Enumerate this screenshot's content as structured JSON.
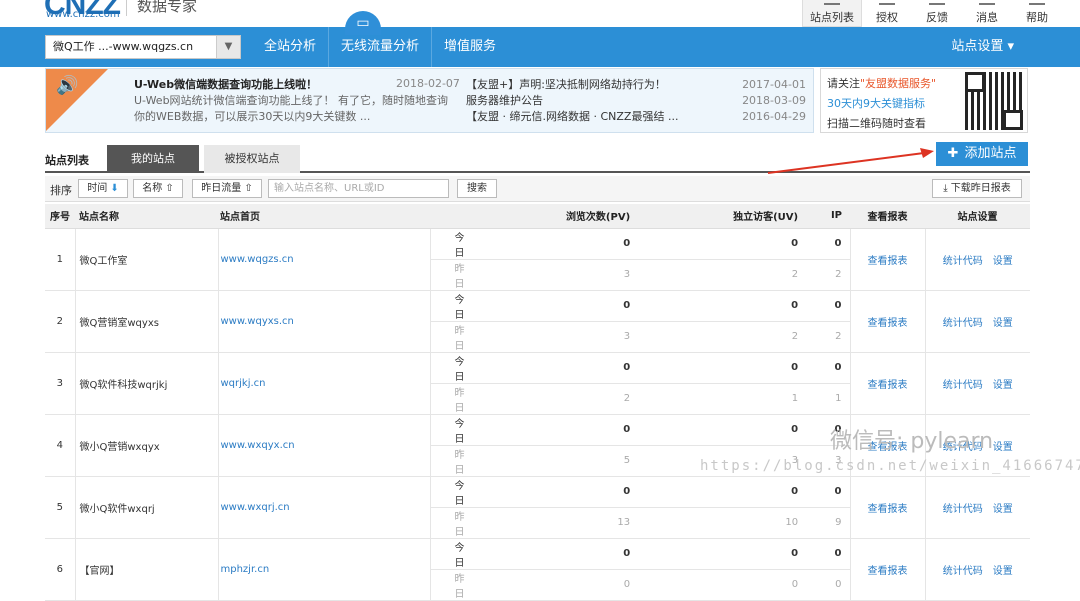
{
  "brand": {
    "logo": "CNZZ",
    "url": "www.cnzz.com",
    "product": "数据专家"
  },
  "top_nav": [
    {
      "label": "站点列表",
      "active": true
    },
    {
      "label": "授权"
    },
    {
      "label": "反馈"
    },
    {
      "label": "消息"
    },
    {
      "label": "帮助"
    }
  ],
  "site_select": "微Q工作 ...-www.wqgzs.cn",
  "menu": [
    "全站分析",
    "无线流量分析",
    "增值服务"
  ],
  "settings": "站点设置",
  "notice": {
    "headline": "U-Web微信端数据查询功能上线啦！",
    "headline_date": "2018-02-07",
    "body": "U-Web网站统计微信端查询功能上线了！ 有了它，随时随地查询你的WEB数据，可以展示30天以内9大关键数 ...",
    "items": [
      {
        "text": "【友盟+】声明:坚决抵制网络劫持行为！",
        "date": "2017-04-01"
      },
      {
        "text": "服务器维护公告",
        "date": "2018-03-09"
      },
      {
        "text": "【友盟 · 缔元信.网络数据 · CNZZ最强结 ...",
        "date": "2016-04-29"
      }
    ]
  },
  "qr": {
    "line1_pre": "请关注",
    "line1_hl": "\"友盟数据服务\"",
    "line2": "30天内9大关键指标",
    "line3": "扫描二维码随时查看"
  },
  "tabs": {
    "label": "站点列表",
    "mine": "我的站点",
    "authorized": "被授权站点"
  },
  "add_button": "添加站点",
  "toolbar": {
    "sort_label": "排序",
    "time": "时间",
    "name": "名称",
    "yesterday": "昨日流量",
    "search_placeholder": "输入站点名称、URL或ID",
    "search": "搜索",
    "download": "下载昨日报表"
  },
  "columns": {
    "idx": "序号",
    "name": "站点名称",
    "url": "站点首页",
    "pv": "浏览次数(PV)",
    "uv": "独立访客(UV)",
    "ip": "IP",
    "report": "查看报表",
    "settings": "站点设置"
  },
  "row_labels": {
    "today": "今日",
    "yesterday": "昨日",
    "report": "查看报表",
    "code": "统计代码",
    "set": "设置"
  },
  "sites": [
    {
      "idx": "1",
      "name": "微Q工作室",
      "url": "www.wqgzs.cn",
      "today": [
        "0",
        "0",
        "0"
      ],
      "yesterday": [
        "3",
        "2",
        "2"
      ]
    },
    {
      "idx": "2",
      "name": "微Q营销室wqyxs",
      "url": "www.wqyxs.cn",
      "today": [
        "0",
        "0",
        "0"
      ],
      "yesterday": [
        "3",
        "2",
        "2"
      ]
    },
    {
      "idx": "3",
      "name": "微Q软件科技wqrjkj",
      "url": "wqrjkj.cn",
      "today": [
        "0",
        "0",
        "0"
      ],
      "yesterday": [
        "2",
        "1",
        "1"
      ]
    },
    {
      "idx": "4",
      "name": "微小Q营销wxqyx",
      "url": "www.wxqyx.cn",
      "today": [
        "0",
        "0",
        "0"
      ],
      "yesterday": [
        "5",
        "3",
        "3"
      ]
    },
    {
      "idx": "5",
      "name": "微小Q软件wxqrj",
      "url": "www.wxqrj.cn",
      "today": [
        "0",
        "0",
        "0"
      ],
      "yesterday": [
        "13",
        "10",
        "9"
      ]
    },
    {
      "idx": "6",
      "name": "【官网】",
      "url": "mphzjr.cn",
      "today": [
        "0",
        "0",
        "0"
      ],
      "yesterday": [
        "0",
        "0",
        "0"
      ]
    }
  ],
  "watermark": "微信号: pylearn",
  "watermark2": "https://blog.csdn.net/weixin_41666747"
}
